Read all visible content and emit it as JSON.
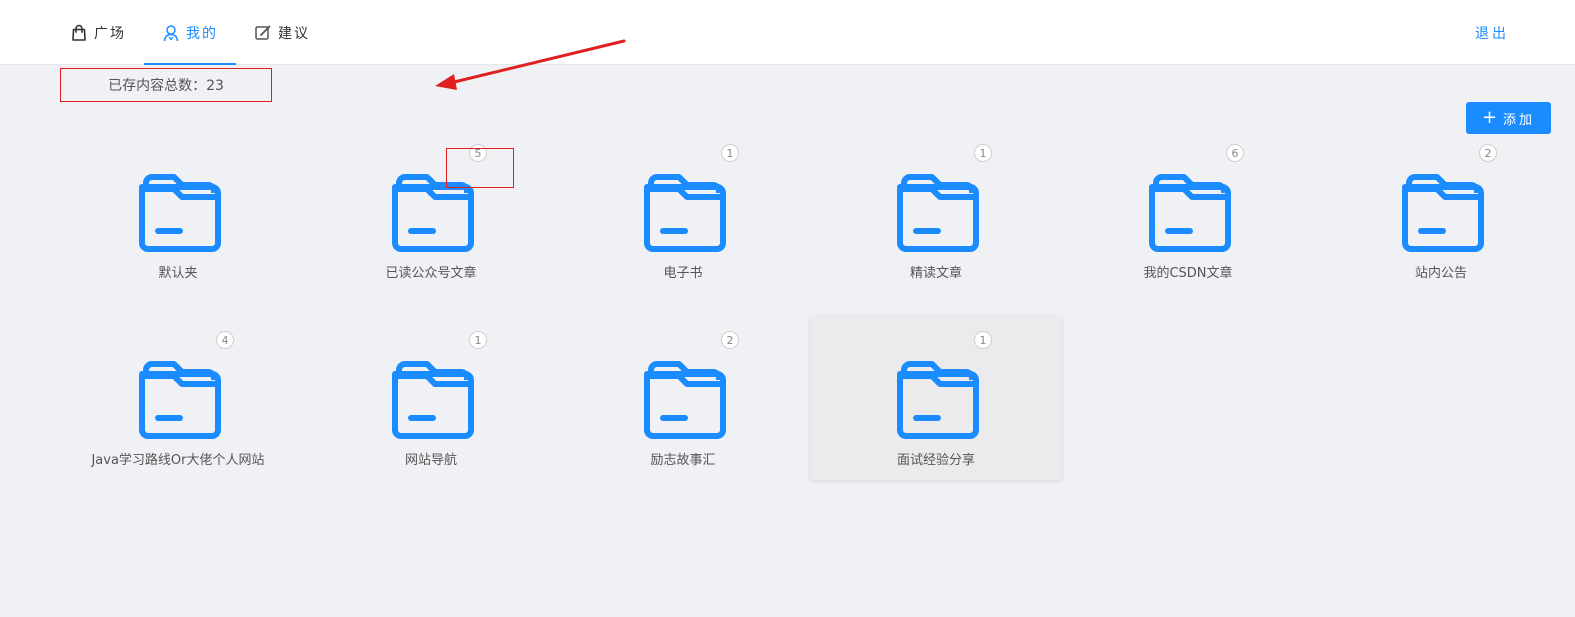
{
  "nav": {
    "tabs": [
      {
        "label": "广场",
        "icon": "shopping-bag-icon"
      },
      {
        "label": "我的",
        "icon": "user-icon"
      },
      {
        "label": "建议",
        "icon": "edit-icon"
      }
    ],
    "logout_label": "退出"
  },
  "summary": {
    "total_text": "已存内容总数：23"
  },
  "toolbar": {
    "add_label": "添加",
    "add_icon": "plus-icon"
  },
  "folders": [
    {
      "name": "默认夹",
      "count": ""
    },
    {
      "name": "已读公众号文章",
      "count": "5"
    },
    {
      "name": "电子书",
      "count": "1"
    },
    {
      "name": "精读文章",
      "count": "1"
    },
    {
      "name": "我的CSDN文章",
      "count": "6"
    },
    {
      "name": "站内公告",
      "count": "2"
    },
    {
      "name": "Java学习路线Or大佬个人网站",
      "count": "4"
    },
    {
      "name": "网站导航",
      "count": "1"
    },
    {
      "name": "励志故事汇",
      "count": "2"
    },
    {
      "name": "面试经验分享",
      "count": "1"
    }
  ],
  "colors": {
    "accent": "#1a8cff",
    "annotation": "#e02020",
    "background": "#f0f1f5"
  }
}
